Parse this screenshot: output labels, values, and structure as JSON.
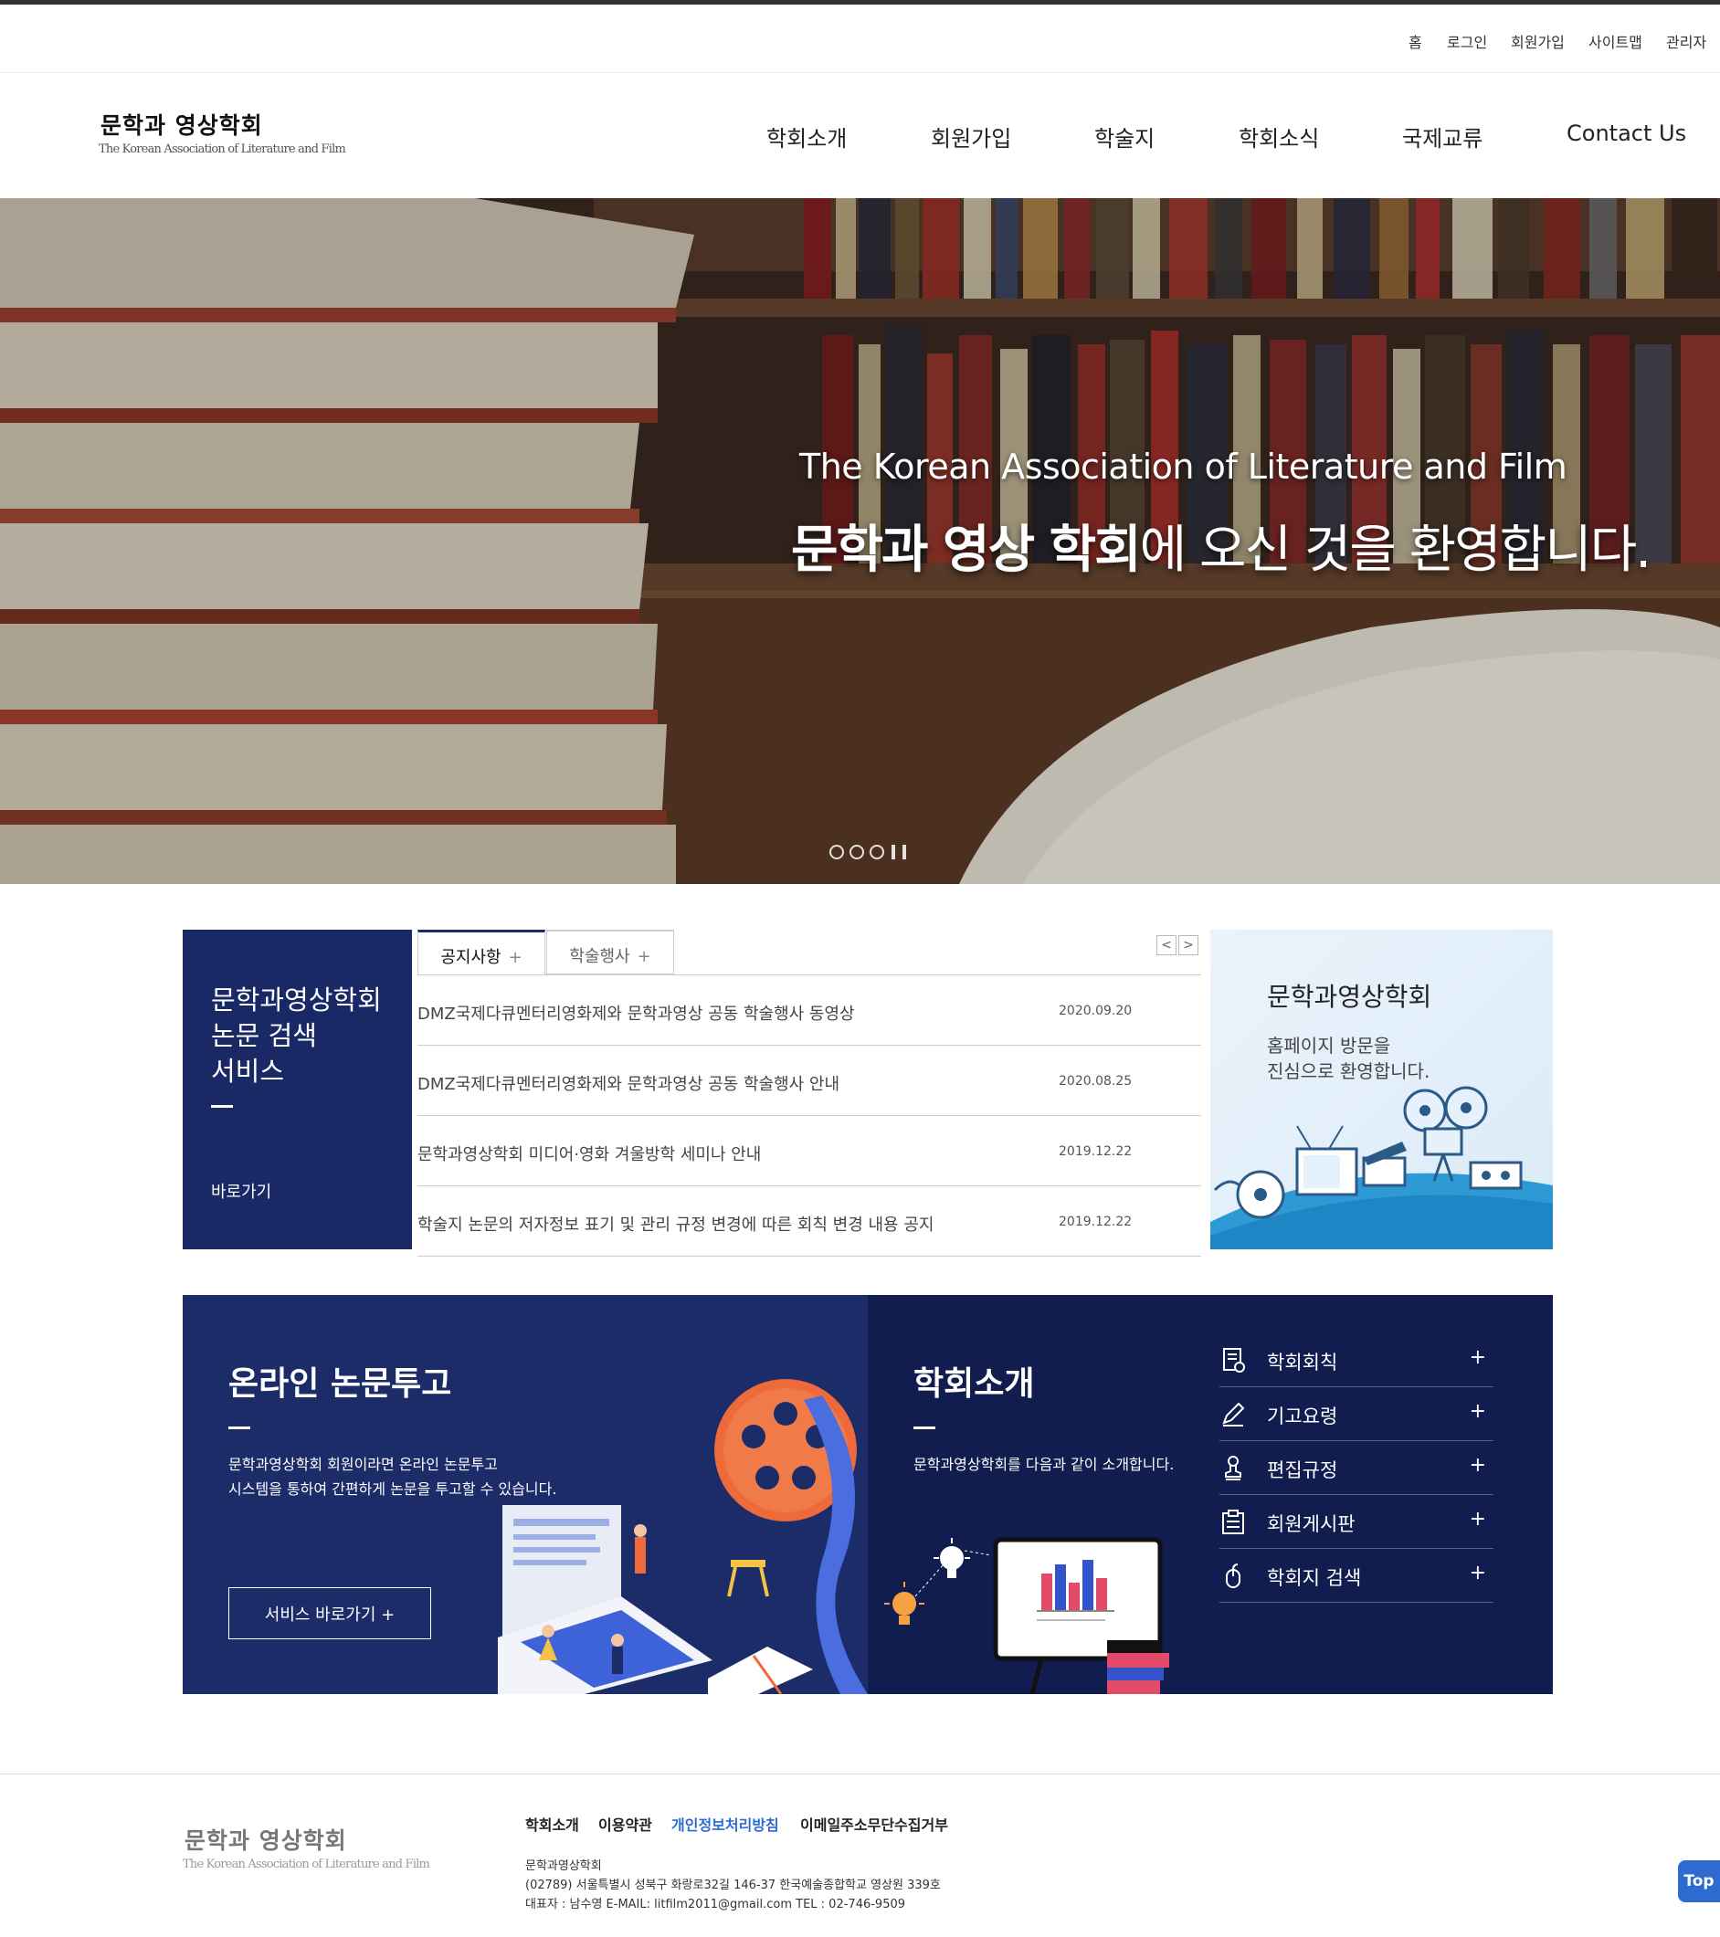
{
  "util_nav": [
    "홈",
    "로그인",
    "회원가입",
    "사이트맵",
    "관리자"
  ],
  "logo": {
    "ko": "문학과 영상학회",
    "en": "The Korean Association of Literature and Film"
  },
  "gnb": [
    "학회소개",
    "회원가입",
    "학술지",
    "학회소식",
    "국제교류",
    "Contact Us"
  ],
  "hero": {
    "subtitle": "The Korean Association of Literature and Film",
    "title_bold": "문학과 영상 학회",
    "title_rest": "에 오신 것을 환영합니다."
  },
  "search_box": {
    "line1": "문학과영상학회",
    "line2": "논문 검색",
    "line3": "서비스",
    "link": "바로가기"
  },
  "tabs": {
    "active": "공지사항",
    "inactive": "학술행사",
    "plus": "+",
    "prev": "<",
    "next": ">"
  },
  "notices": [
    {
      "title": "DMZ국제다큐멘터리영화제와 문학과영상 공동 학술행사 동영상",
      "date": "2020.09.20"
    },
    {
      "title": "DMZ국제다큐멘터리영화제와 문학과영상 공동 학술행사 안내",
      "date": "2020.08.25"
    },
    {
      "title": "문학과영상학회 미디어·영화 겨울방학 세미나 안내",
      "date": "2019.12.22"
    },
    {
      "title": "학술지 논문의 저자정보 표기 및 관리 규정 변경에 따른 회칙 변경 내용 공지",
      "date": "2019.12.22"
    }
  ],
  "welcome": {
    "title": "문학과영상학회",
    "line1": "홈페이지 방문을",
    "line2": "진심으로 환영합니다."
  },
  "paper": {
    "title": "온라인 논문투고",
    "line1": "문학과영상학회 회원이라면 온라인 논문투고",
    "line2": "시스템을 통하여 간편하게 논문을 투고할 수 있습니다.",
    "button": "서비스 바로가기 +"
  },
  "intro": {
    "title": "학회소개",
    "desc": "문학과영상학회를 다음과 같이 소개합니다.",
    "menu": [
      {
        "label": "학회회칙",
        "icon": "document-icon"
      },
      {
        "label": "기고요령",
        "icon": "pen-icon"
      },
      {
        "label": "편집규정",
        "icon": "stamp-icon"
      },
      {
        "label": "회원게시판",
        "icon": "clipboard-icon"
      },
      {
        "label": "학회지 검색",
        "icon": "mouse-icon"
      }
    ],
    "plus": "+"
  },
  "footer": {
    "logo_ko": "문학과 영상학회",
    "logo_en": "The Korean Association of Literature and Film",
    "links": [
      "학회소개",
      "이용약관",
      "개인정보처리방침",
      "이메일주소무단수집거부"
    ],
    "org": "문학과영상학회",
    "address": "(02789) 서울특별시 성북구 화랑로32길 146-37 한국예술종합학교 영상원 339호",
    "contact": "대표자 : 남수영   E-MAIL: litfilm2011@gmail.com   TEL : 02-746-9509"
  },
  "top_button": "Top",
  "colors": {
    "navy": "#192966",
    "navy_dark": "#101d4e",
    "link_blue": "#2d6bd3"
  }
}
